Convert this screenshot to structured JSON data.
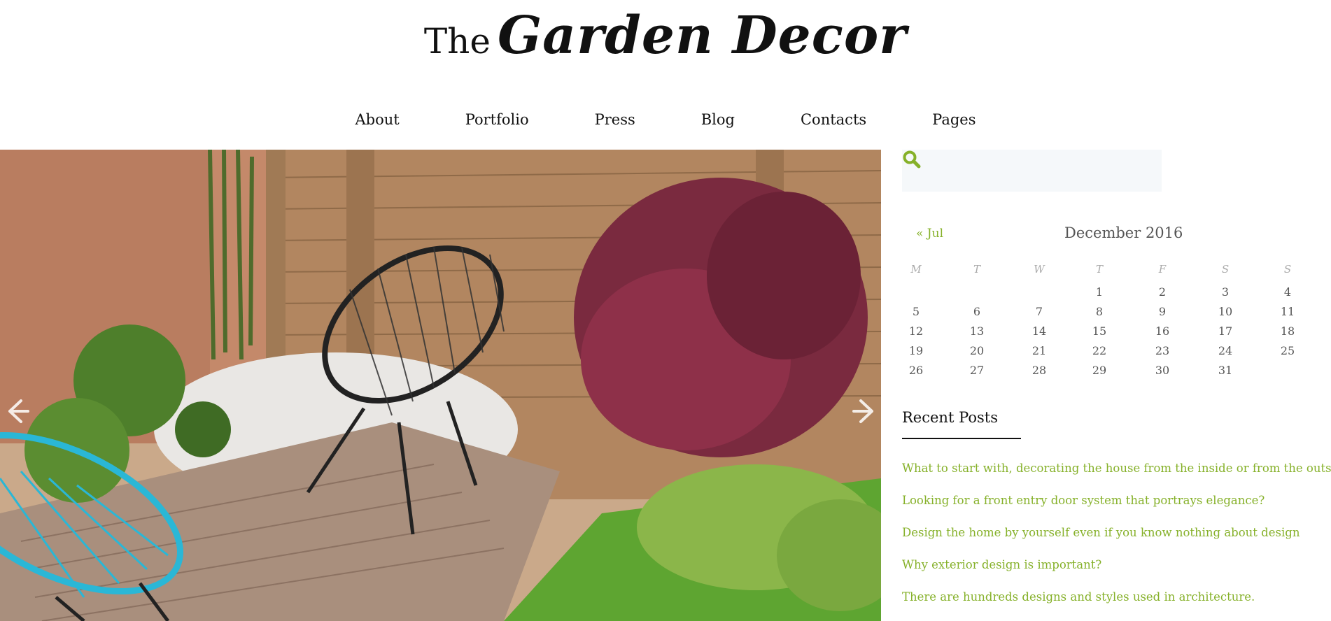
{
  "site": {
    "logo_prefix": "The",
    "logo_script": "Garden Decor"
  },
  "nav": {
    "items": [
      "About",
      "Portfolio",
      "Press",
      "Blog",
      "Contacts",
      "Pages"
    ]
  },
  "search": {
    "placeholder": "",
    "value": "",
    "icon": "search-icon"
  },
  "calendar": {
    "prev_label": "« Jul",
    "title": "December 2016",
    "weekdays": [
      "M",
      "T",
      "W",
      "T",
      "F",
      "S",
      "S"
    ],
    "weeks": [
      [
        "",
        "",
        "",
        "1",
        "2",
        "3",
        "4"
      ],
      [
        "5",
        "6",
        "7",
        "8",
        "9",
        "10",
        "11"
      ],
      [
        "12",
        "13",
        "14",
        "15",
        "16",
        "17",
        "18"
      ],
      [
        "19",
        "20",
        "21",
        "22",
        "23",
        "24",
        "25"
      ],
      [
        "26",
        "27",
        "28",
        "29",
        "30",
        "31",
        ""
      ]
    ]
  },
  "recent_posts": {
    "title": "Recent Posts",
    "items": [
      "What to start with, decorating the house from the inside or from the outside?",
      "Looking for a front entry door system that portrays elegance?",
      "Design the home by yourself even if you know nothing about design",
      "Why exterior design is important?",
      "There are hundreds designs and styles used in architecture."
    ]
  },
  "colors": {
    "accent": "#86b12a",
    "text": "#111111",
    "search_bg": "#f5f8fa"
  }
}
